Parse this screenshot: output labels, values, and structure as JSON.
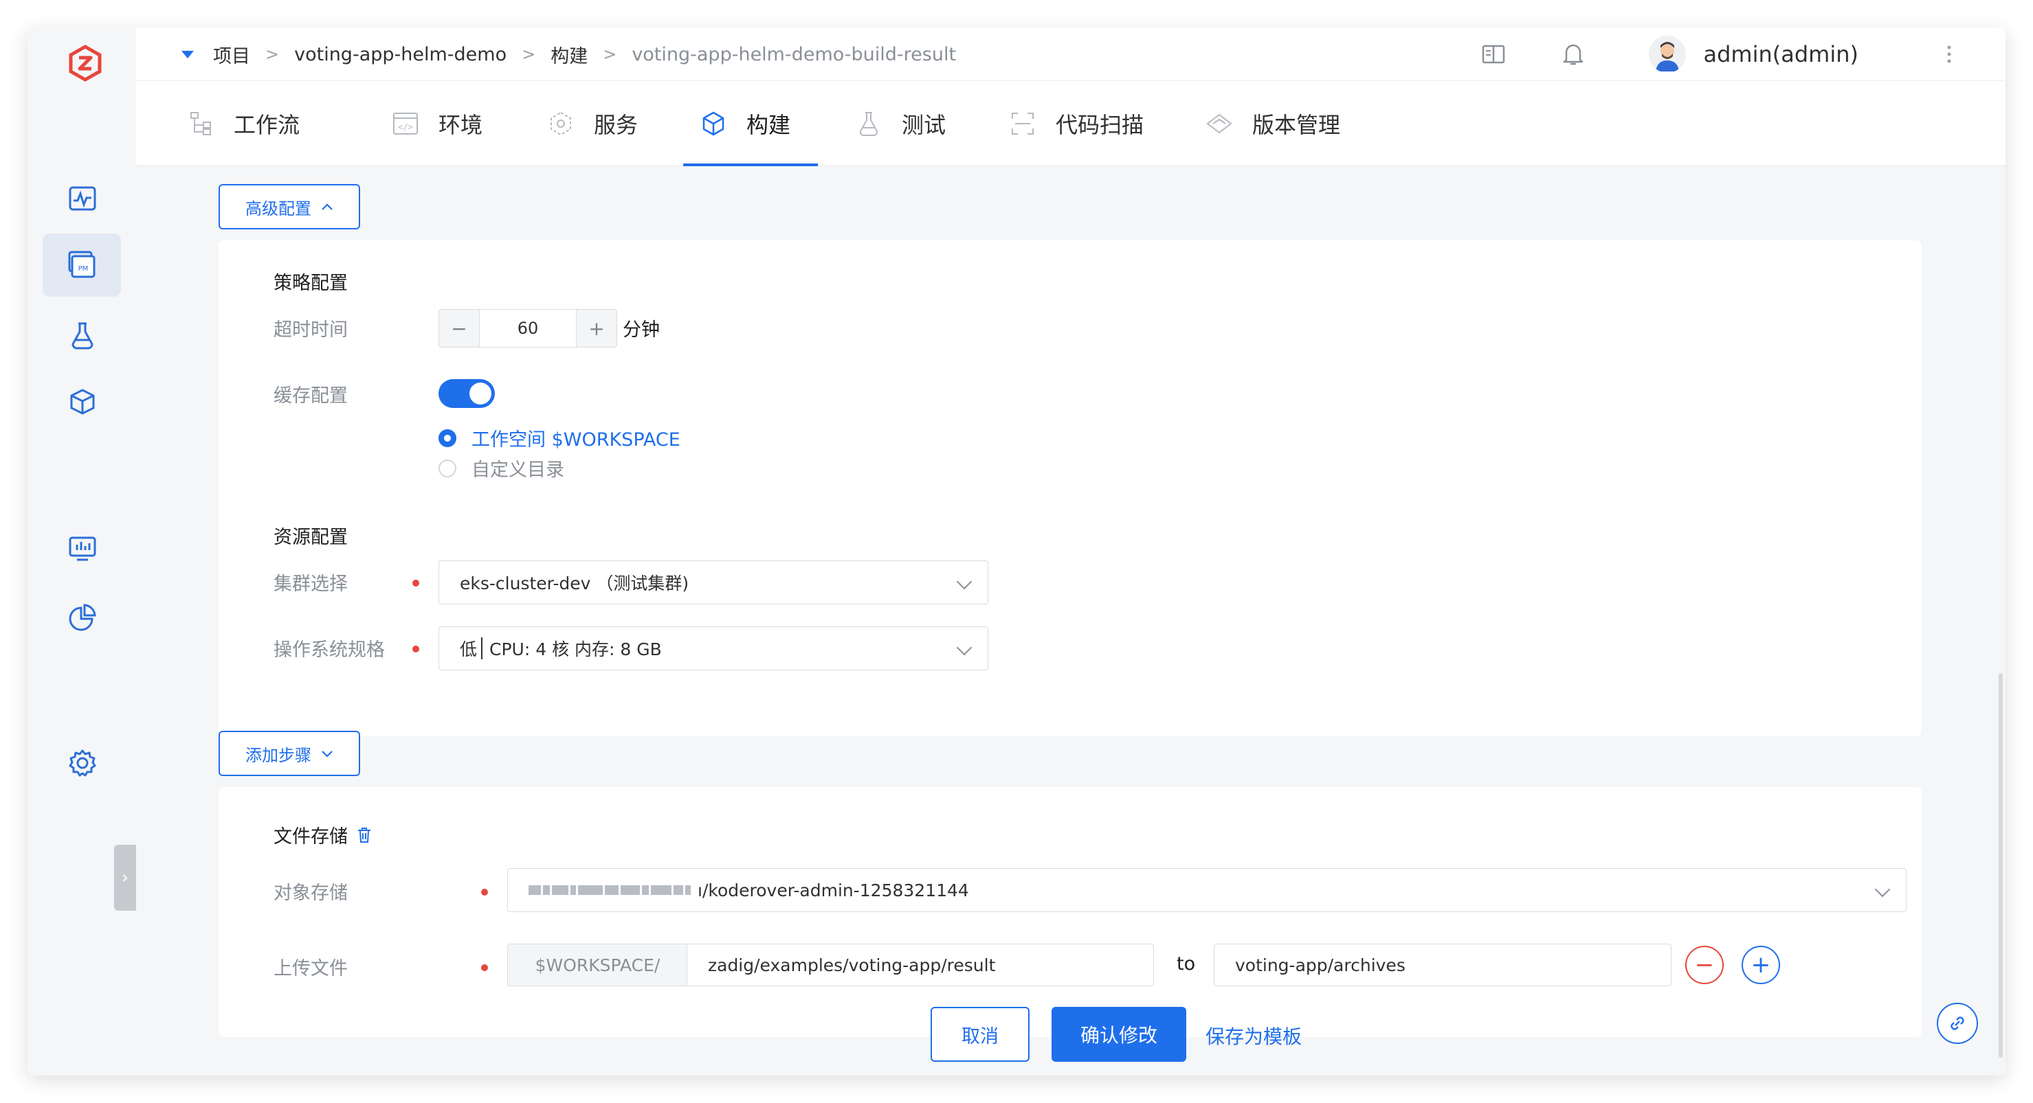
{
  "breadcrumb": {
    "items": [
      "项目",
      "voting-app-helm-demo",
      "构建",
      "voting-app-helm-demo-build-result"
    ],
    "separator": ">"
  },
  "header": {
    "user_name": "admin(admin)"
  },
  "tabs": [
    {
      "label": "工作流",
      "icon": "workflow-icon"
    },
    {
      "label": "环境",
      "icon": "environment-icon"
    },
    {
      "label": "服务",
      "icon": "service-icon"
    },
    {
      "label": "构建",
      "icon": "build-icon",
      "active": true
    },
    {
      "label": "测试",
      "icon": "test-flask-icon"
    },
    {
      "label": "代码扫描",
      "icon": "code-scan-icon"
    },
    {
      "label": "版本管理",
      "icon": "version-icon"
    }
  ],
  "advanced": {
    "toggle_label": "高级配置",
    "strategy_title": "策略配置",
    "timeout_label": "超时时间",
    "timeout_value": "60",
    "timeout_unit": "分钟",
    "cache_label": "缓存配置",
    "cache_enabled": true,
    "cache_options": [
      "工作空间 $WORKSPACE",
      "自定义目录"
    ],
    "cache_selected": "工作空间 $WORKSPACE",
    "resource_title": "资源配置",
    "cluster_label": "集群选择",
    "cluster_value": "eks-cluster-dev （测试集群)",
    "os_label": "操作系统规格",
    "os_level": "低",
    "os_spec": "CPU: 4 核 内存: 8 GB"
  },
  "add_step": {
    "label": "添加步骤"
  },
  "file_storage": {
    "title": "文件存储",
    "object_storage_label": "对象存储",
    "object_storage_value": "ı/koderover-admin-1258321144",
    "upload_label": "上传文件",
    "upload_prefix": "$WORKSPACE/",
    "upload_source": "zadig/examples/voting-app/result",
    "to_label": "to",
    "upload_dest": "voting-app/archives",
    "remove_symbol": "−",
    "add_symbol": "+"
  },
  "actions": {
    "cancel": "取消",
    "confirm": "确认修改",
    "save_template": "保存为模板"
  },
  "colors": {
    "primary": "#1f6feb",
    "danger": "#e8463c",
    "logo": "#e8463c"
  }
}
